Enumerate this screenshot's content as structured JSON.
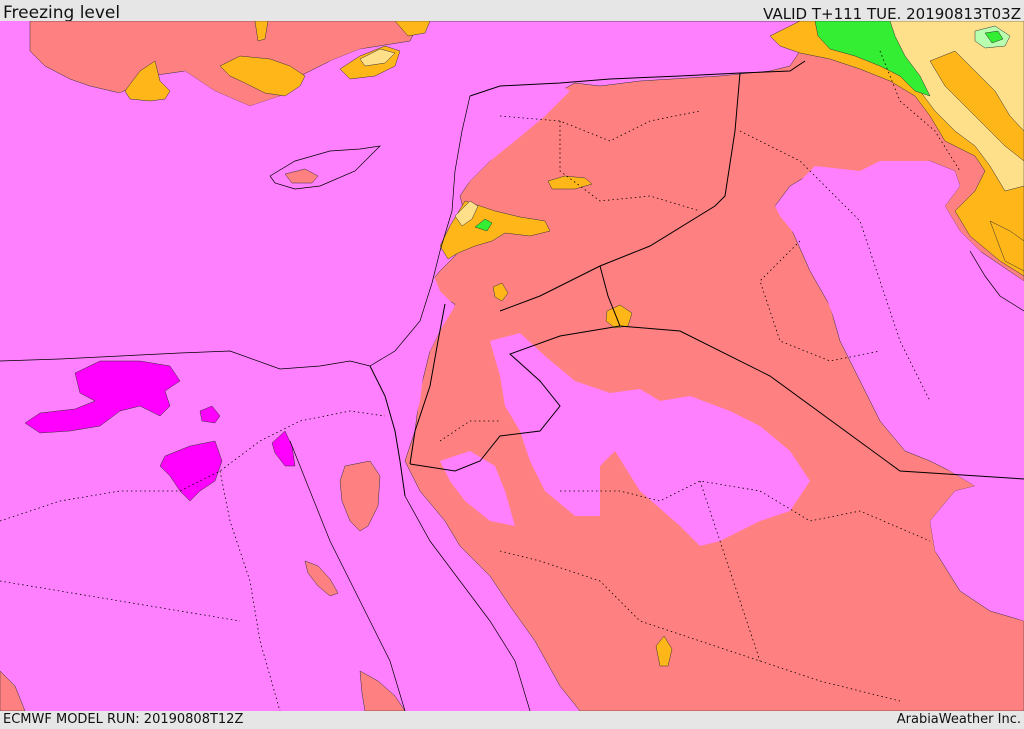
{
  "header": {
    "title": "Freezing level",
    "valid_time": "VALID T+111 TUE. 20190813T03Z"
  },
  "footer": {
    "model_run": "ECMWF MODEL RUN: 20190808T12Z",
    "credit": "ArabiaWeather Inc."
  },
  "map": {
    "colors": {
      "sea": "#ff80ff",
      "land_high": "#ff8080",
      "band_orange": "#ffb619",
      "band_lightorange": "#ffe08a",
      "band_green": "#33ee33",
      "band_lightgreen": "#b8ffb0",
      "band_magenta": "#ff00ff",
      "border_line": "#000000"
    }
  }
}
